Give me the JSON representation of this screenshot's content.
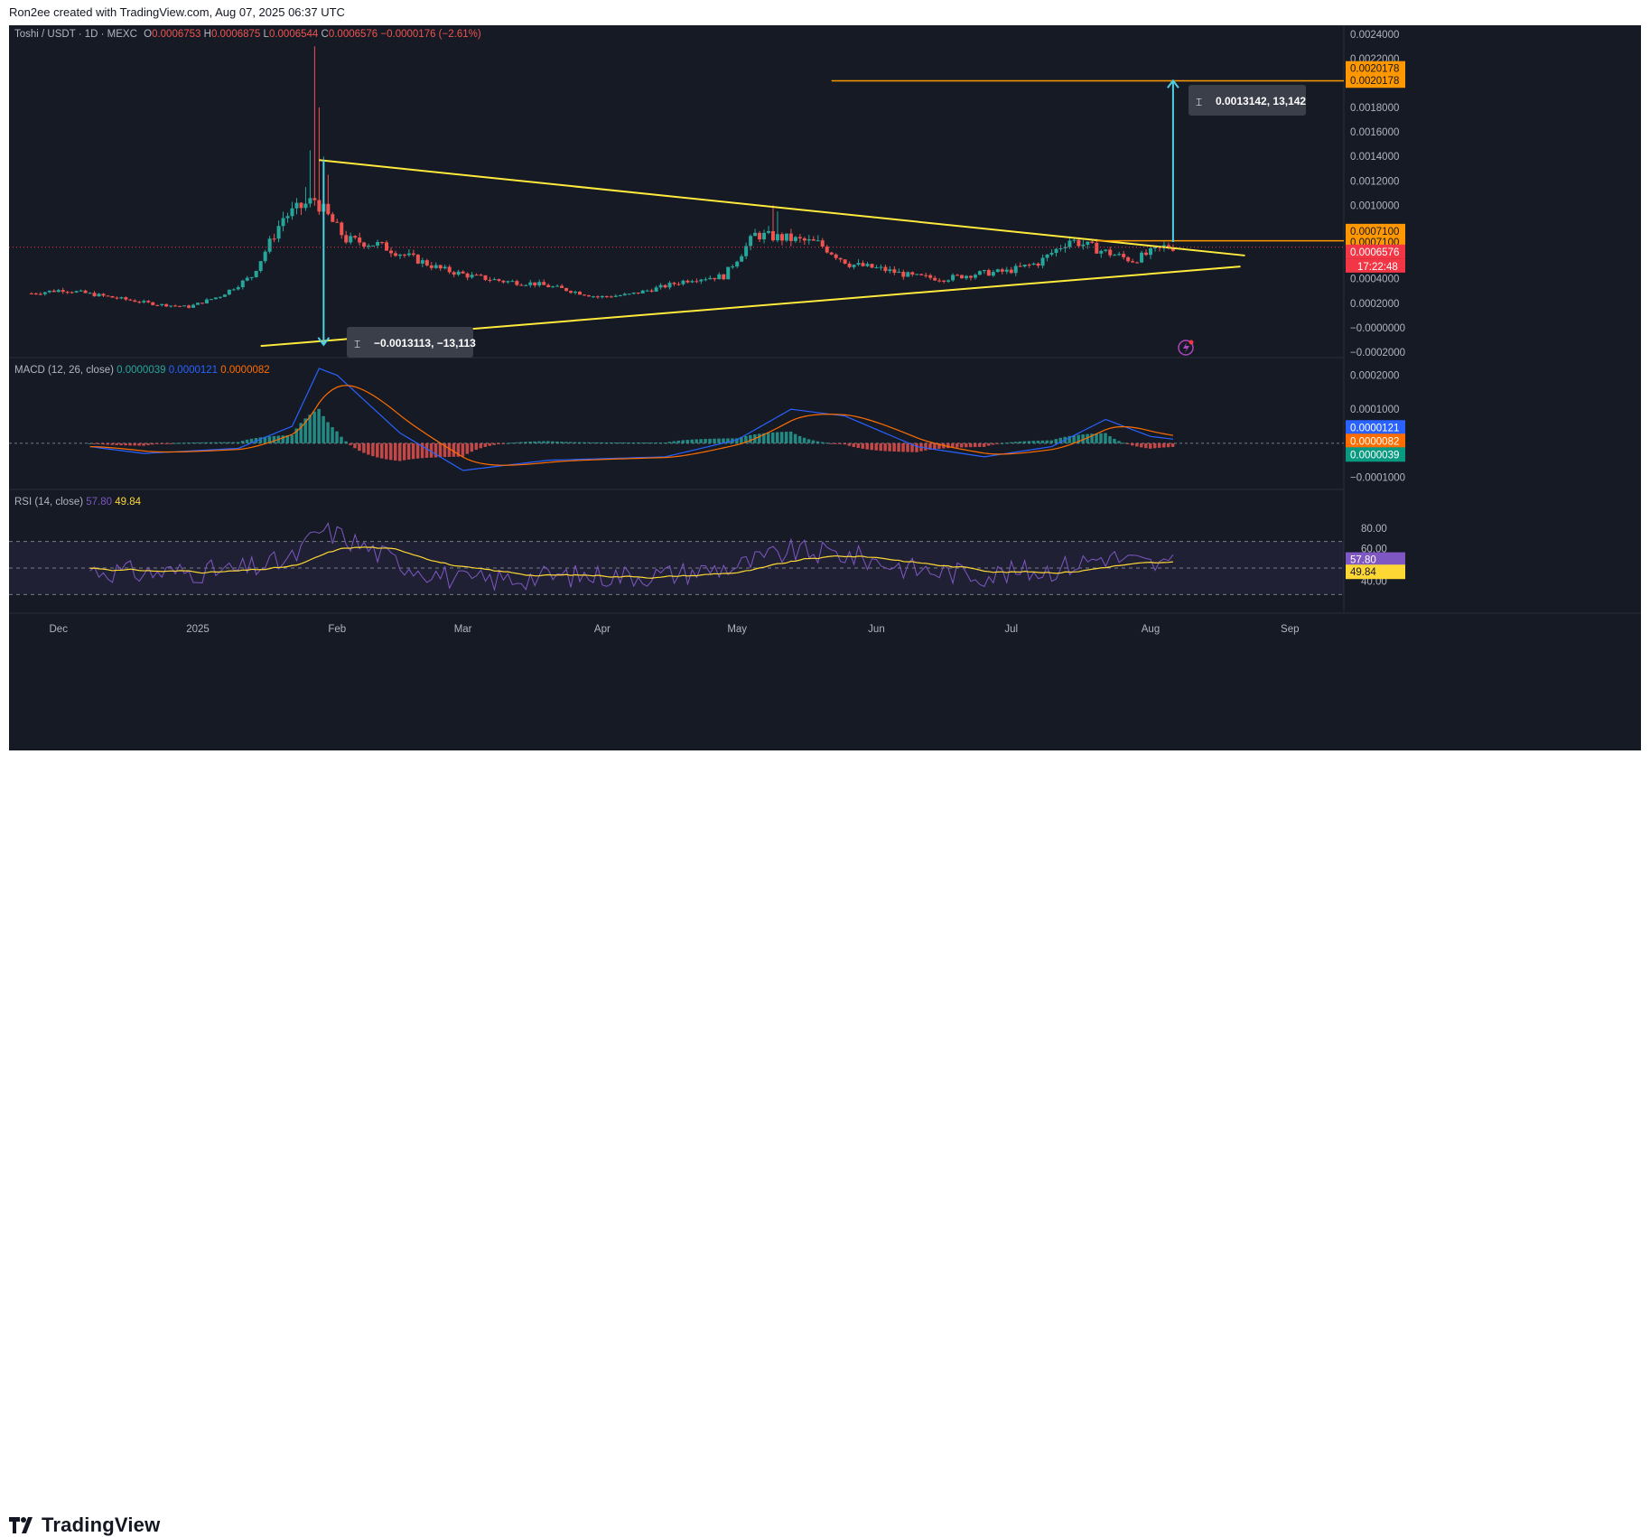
{
  "header": {
    "credit": "Ron2ee created with TradingView.com, Aug 07, 2025 06:37 UTC"
  },
  "footer": {
    "brand": "TradingView"
  },
  "symbol": {
    "name": "Toshi / USDT · 1D · MEXC",
    "o_label": "O",
    "o": "0.0006753",
    "h_label": "H",
    "h": "0.0006875",
    "l_label": "L",
    "l": "0.0006544",
    "c_label": "C",
    "c": "0.0006576",
    "change": "−0.0000176 (−2.61%)"
  },
  "macd_legend": {
    "name": "MACD (12, 26, close)",
    "v1": "0.0000039",
    "v2": "0.0000121",
    "v3": "0.0000082"
  },
  "rsi_legend": {
    "name": "RSI (14, close)",
    "v1": "57.80",
    "v2": "49.84"
  },
  "price_axis": {
    "ticks": [
      "0.0024000",
      "0.0022000",
      "0.0018000",
      "0.0016000",
      "0.0014000",
      "0.0012000",
      "0.0010000",
      "0.0004000",
      "0.0002000",
      "−0.0000000",
      "−0.0002000"
    ]
  },
  "price_badges": {
    "target_a": "0.0020178",
    "target_b": "0.0020178",
    "breakout_a": "0.0007100",
    "breakout_b": "0.0007100",
    "last": "0.0006576",
    "countdown": "17:22:48"
  },
  "macd_axis": {
    "ticks": [
      "0.0002000",
      "0.0001000",
      "−0.0001000"
    ],
    "badges": [
      "0.0000121",
      "0.0000082",
      "0.0000039"
    ]
  },
  "rsi_axis": {
    "ticks": [
      "80.00",
      "40.00"
    ],
    "badges": [
      "57.80",
      "49.84"
    ],
    "hidden_tick": "60.00"
  },
  "time_axis": {
    "labels": [
      "Dec",
      "2025",
      "Feb",
      "Mar",
      "Apr",
      "May",
      "Jun",
      "Jul",
      "Aug",
      "Sep"
    ]
  },
  "measure_up": {
    "label": "0.0013142, 13,142"
  },
  "measure_down": {
    "label": "−0.0013113, −13,113"
  },
  "colors": {
    "bg": "#161a25",
    "up": "#26a69a",
    "down": "#ef5350",
    "trend": "#ffeb3b",
    "orange": "#ff9800",
    "cyan": "#4dd0e1",
    "macd": "#2962ff",
    "signal": "#ff6d00",
    "rsi": "#7e57c2",
    "rsi_ma": "#fdd835",
    "red_badge": "#f23645",
    "macd_badge": "#089981"
  },
  "chart_data": {
    "type": "candlestick",
    "title": "Toshi / USDT · 1D · MEXC",
    "x_range": [
      "2024-11-20",
      "2025-09-13"
    ],
    "y_range": [
      -0.00023,
      0.00245
    ],
    "weekly_closes": {
      "x": [
        "2024-11-25",
        "2024-12-02",
        "2024-12-09",
        "2024-12-16",
        "2024-12-23",
        "2024-12-30",
        "2025-01-06",
        "2025-01-13",
        "2025-01-20",
        "2025-01-27",
        "2025-02-03",
        "2025-02-10",
        "2025-02-17",
        "2025-02-24",
        "2025-03-03",
        "2025-03-10",
        "2025-03-17",
        "2025-03-24",
        "2025-03-31",
        "2025-04-07",
        "2025-04-14",
        "2025-04-21",
        "2025-04-28",
        "2025-05-05",
        "2025-05-12",
        "2025-05-19",
        "2025-05-26",
        "2025-06-02",
        "2025-06-09",
        "2025-06-16",
        "2025-06-23",
        "2025-06-30",
        "2025-07-07",
        "2025-07-14",
        "2025-07-21",
        "2025-07-28",
        "2025-08-04"
      ],
      "y": [
        0.00028,
        0.00031,
        0.00027,
        0.00023,
        0.00019,
        0.00017,
        0.00026,
        0.00042,
        0.0009,
        0.00105,
        0.00072,
        0.00068,
        0.00058,
        0.00048,
        0.00042,
        0.00038,
        0.00036,
        0.00031,
        0.00025,
        0.00027,
        0.00033,
        0.0004,
        0.00042,
        0.00076,
        0.00073,
        0.00069,
        0.00052,
        0.00048,
        0.00042,
        0.0004,
        0.00044,
        0.00046,
        0.00053,
        0.00072,
        0.00063,
        0.00055,
        0.00066
      ]
    },
    "triangle": {
      "upper": {
        "x": [
          "2025-01-28",
          "2025-08-22"
        ],
        "y": [
          0.00137,
          0.00059
        ]
      },
      "lower": {
        "x": [
          "2025-01-15",
          "2025-08-21"
        ],
        "y": [
          -0.00015,
          0.0005
        ]
      }
    },
    "levels": [
      {
        "name": "target",
        "y": 0.0020178
      },
      {
        "name": "breakout",
        "y": 0.00071
      }
    ],
    "measures": [
      {
        "label": "0.0013142, 13,142",
        "x": "2025-08-06",
        "y": [
          0.0007,
          0.00202
        ]
      },
      {
        "label": "−0.0013113, −13,113",
        "x": "2025-01-29",
        "y": [
          0.00137,
          -0.00014
        ]
      }
    ],
    "macd": {
      "fast": 12,
      "slow": 26,
      "source": "close",
      "ylim": [
        -0.00012,
        0.00024
      ],
      "last": {
        "hist": 3.9e-06,
        "macd": 1.21e-05,
        "signal": 8.2e-06
      }
    },
    "rsi": {
      "length": 14,
      "source": "close",
      "ylim": [
        20,
        95
      ],
      "bands": [
        70,
        50,
        30
      ],
      "last": {
        "rsi": 57.8,
        "ma": 49.84
      }
    }
  }
}
